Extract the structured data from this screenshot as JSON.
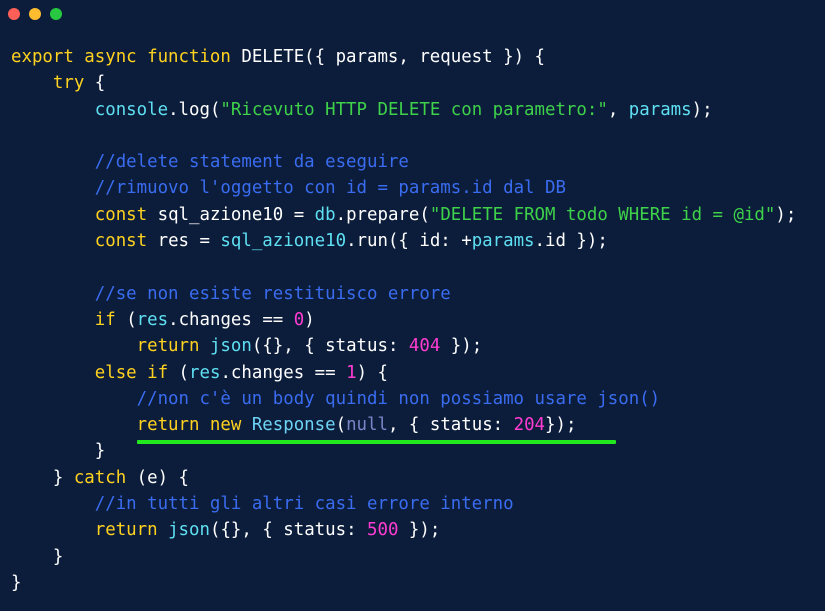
{
  "window": {
    "dots": [
      {
        "name": "close",
        "color": "#ff5f57"
      },
      {
        "name": "minimize",
        "color": "#febc2e"
      },
      {
        "name": "maximize",
        "color": "#28c840"
      }
    ]
  },
  "colors": {
    "background": "#0c1d3b",
    "keyword": "#ffd21f",
    "identifier": "#5fe0f2",
    "string": "#3ed14a",
    "comment": "#3a6cf0",
    "number": "#ff3cd2",
    "highlight_underline": "#22e81e"
  },
  "highlight": {
    "line_index": 14
  },
  "code_lines": [
    [
      {
        "t": "export async function ",
        "c": "keyword"
      },
      {
        "t": "DELETE({ params, request }) {",
        "c": "white"
      }
    ],
    [
      {
        "t": "    ",
        "c": "white"
      },
      {
        "t": "try",
        "c": "keyword"
      },
      {
        "t": " {",
        "c": "white"
      }
    ],
    [
      {
        "t": "        ",
        "c": "white"
      },
      {
        "t": "console",
        "c": "teal"
      },
      {
        "t": ".log(",
        "c": "white"
      },
      {
        "t": "\"Ricevuto HTTP DELETE con parametro:\"",
        "c": "string"
      },
      {
        "t": ", ",
        "c": "white"
      },
      {
        "t": "params",
        "c": "teal"
      },
      {
        "t": ");",
        "c": "white"
      }
    ],
    [],
    [
      {
        "t": "        ",
        "c": "white"
      },
      {
        "t": "//delete statement da eseguire",
        "c": "comment"
      }
    ],
    [
      {
        "t": "        ",
        "c": "white"
      },
      {
        "t": "//rimuovo l'oggetto con id = params.id dal DB",
        "c": "comment"
      }
    ],
    [
      {
        "t": "        ",
        "c": "white"
      },
      {
        "t": "const",
        "c": "keyword"
      },
      {
        "t": " sql_azione10 = ",
        "c": "white"
      },
      {
        "t": "db",
        "c": "teal"
      },
      {
        "t": ".prepare(",
        "c": "white"
      },
      {
        "t": "\"DELETE FROM todo WHERE id = @id\"",
        "c": "string"
      },
      {
        "t": ");",
        "c": "white"
      }
    ],
    [
      {
        "t": "        ",
        "c": "white"
      },
      {
        "t": "const",
        "c": "keyword"
      },
      {
        "t": " res = ",
        "c": "white"
      },
      {
        "t": "sql_azione10",
        "c": "teal"
      },
      {
        "t": ".run({ id: +",
        "c": "white"
      },
      {
        "t": "params",
        "c": "teal"
      },
      {
        "t": ".id });",
        "c": "white"
      }
    ],
    [],
    [
      {
        "t": "        ",
        "c": "white"
      },
      {
        "t": "//se non esiste restituisco errore",
        "c": "comment"
      }
    ],
    [
      {
        "t": "        ",
        "c": "white"
      },
      {
        "t": "if",
        "c": "keyword"
      },
      {
        "t": " (",
        "c": "white"
      },
      {
        "t": "res",
        "c": "teal"
      },
      {
        "t": ".changes == ",
        "c": "white"
      },
      {
        "t": "0",
        "c": "number"
      },
      {
        "t": ")",
        "c": "white"
      }
    ],
    [
      {
        "t": "            ",
        "c": "white"
      },
      {
        "t": "return",
        "c": "keyword"
      },
      {
        "t": " ",
        "c": "white"
      },
      {
        "t": "json",
        "c": "teal"
      },
      {
        "t": "({}, { status: ",
        "c": "white"
      },
      {
        "t": "404",
        "c": "number"
      },
      {
        "t": " });",
        "c": "white"
      }
    ],
    [
      {
        "t": "        ",
        "c": "white"
      },
      {
        "t": "else if",
        "c": "keyword"
      },
      {
        "t": " (",
        "c": "white"
      },
      {
        "t": "res",
        "c": "teal"
      },
      {
        "t": ".changes == ",
        "c": "white"
      },
      {
        "t": "1",
        "c": "number"
      },
      {
        "t": ") {",
        "c": "white"
      }
    ],
    [
      {
        "t": "            ",
        "c": "white"
      },
      {
        "t": "//non c'è un body quindi non possiamo usare json()",
        "c": "comment"
      }
    ],
    [
      {
        "t": "            ",
        "c": "white"
      },
      {
        "t": "return new",
        "c": "keyword"
      },
      {
        "t": " ",
        "c": "white"
      },
      {
        "t": "Response",
        "c": "cyan"
      },
      {
        "t": "(",
        "c": "white"
      },
      {
        "t": "null",
        "c": "null"
      },
      {
        "t": ", { status: ",
        "c": "white"
      },
      {
        "t": "204",
        "c": "number"
      },
      {
        "t": "});",
        "c": "white"
      }
    ],
    [
      {
        "t": "        }",
        "c": "white"
      }
    ],
    [
      {
        "t": "    } ",
        "c": "white"
      },
      {
        "t": "catch",
        "c": "keyword"
      },
      {
        "t": " (e) {",
        "c": "white"
      }
    ],
    [
      {
        "t": "        ",
        "c": "white"
      },
      {
        "t": "//in tutti gli altri casi errore interno",
        "c": "comment"
      }
    ],
    [
      {
        "t": "        ",
        "c": "white"
      },
      {
        "t": "return",
        "c": "keyword"
      },
      {
        "t": " ",
        "c": "white"
      },
      {
        "t": "json",
        "c": "teal"
      },
      {
        "t": "({}, { status: ",
        "c": "white"
      },
      {
        "t": "500",
        "c": "number"
      },
      {
        "t": " });",
        "c": "white"
      }
    ],
    [
      {
        "t": "    }",
        "c": "white"
      }
    ],
    [
      {
        "t": "}",
        "c": "white"
      }
    ]
  ]
}
